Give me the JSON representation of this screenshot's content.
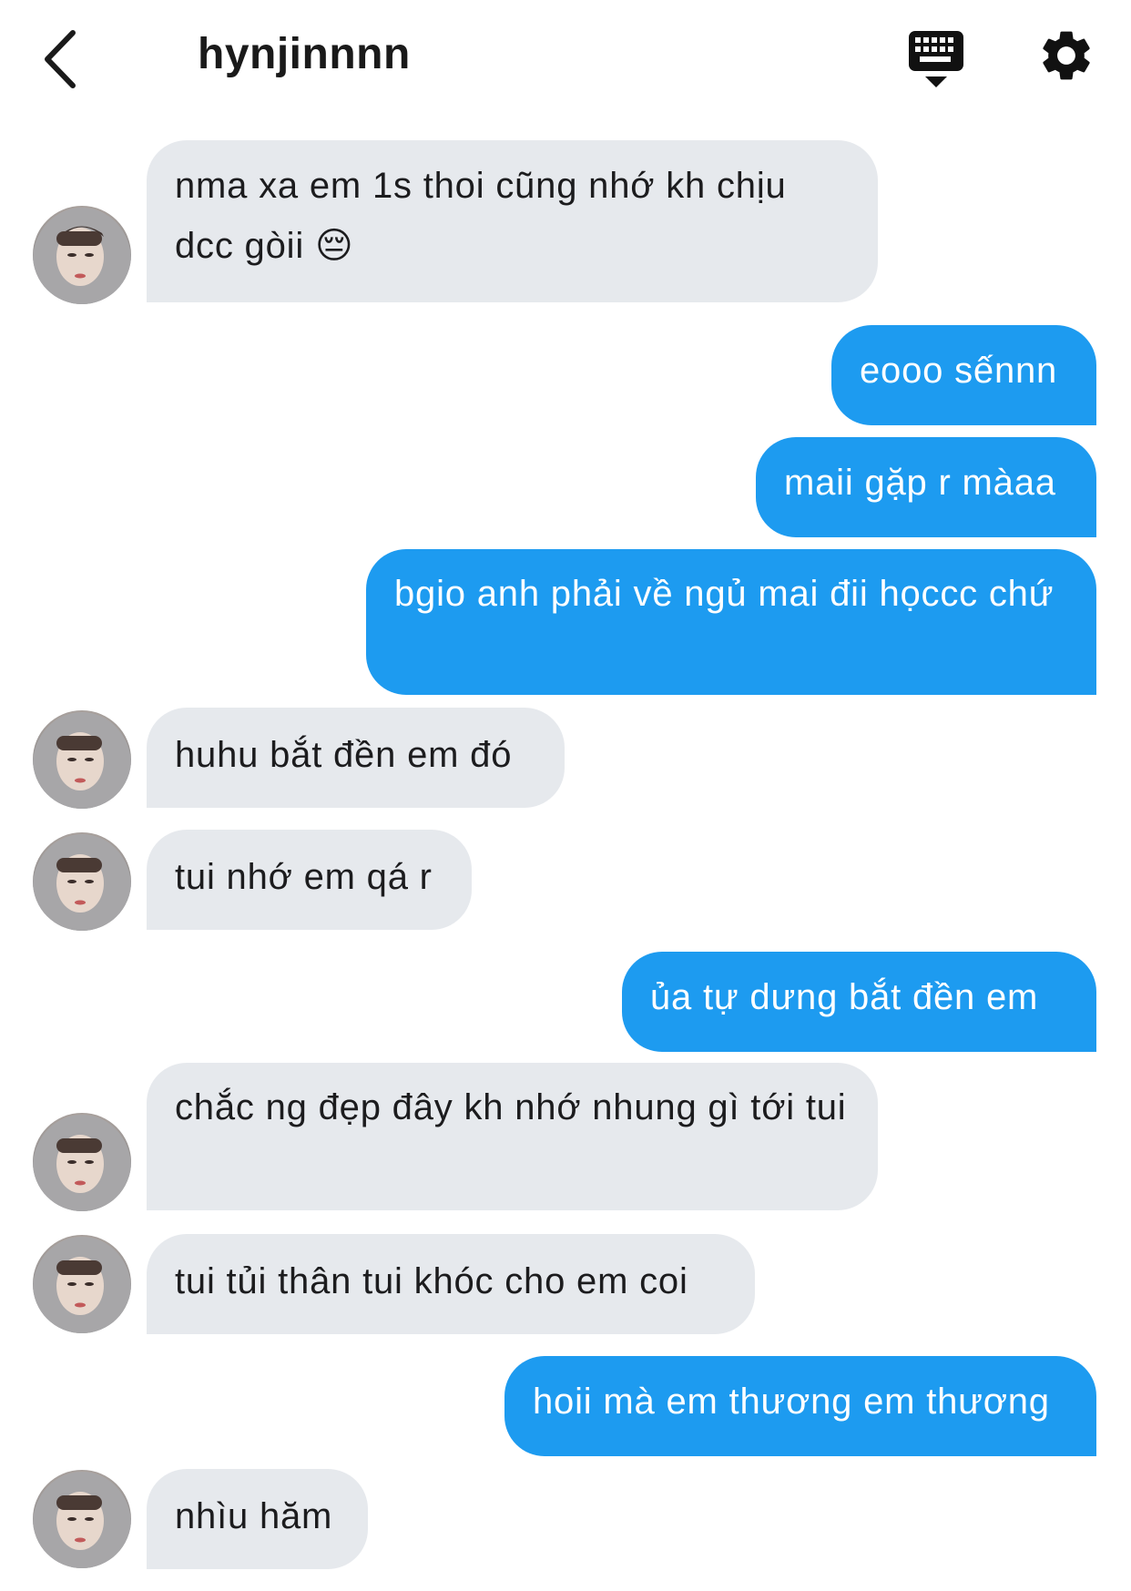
{
  "header": {
    "title": "hynjinnnn",
    "back_icon": "chevron-left-icon",
    "keyboard_icon": "keyboard-icon",
    "settings_icon": "gear-icon"
  },
  "colors": {
    "outgoing_bubble": "#1d9bf0",
    "incoming_bubble": "#e6e9ed",
    "text_dark": "#1c1c1e"
  },
  "messages": [
    {
      "sender": "them",
      "text": "nma xa em 1s thoi cũng nhớ kh chịu dcc gòii 😔"
    },
    {
      "sender": "me",
      "text": "eooo sếnnn"
    },
    {
      "sender": "me",
      "text": "maii gặp r màaa"
    },
    {
      "sender": "me",
      "text": "bgio anh phải về ngủ mai đii họccc chứ"
    },
    {
      "sender": "them",
      "text": "huhu bắt đền em đó"
    },
    {
      "sender": "them",
      "text": "tui nhớ em qá r"
    },
    {
      "sender": "me",
      "text": "ủa tự dưng bắt đền em"
    },
    {
      "sender": "them",
      "text": "chắc ng đẹp đây kh nhớ nhung gì tới tui"
    },
    {
      "sender": "them",
      "text": "tui tủi thân tui khóc cho em coi"
    },
    {
      "sender": "me",
      "text": "hoii mà em thương em thương"
    },
    {
      "sender": "them",
      "text": "nhìu hăm"
    }
  ]
}
